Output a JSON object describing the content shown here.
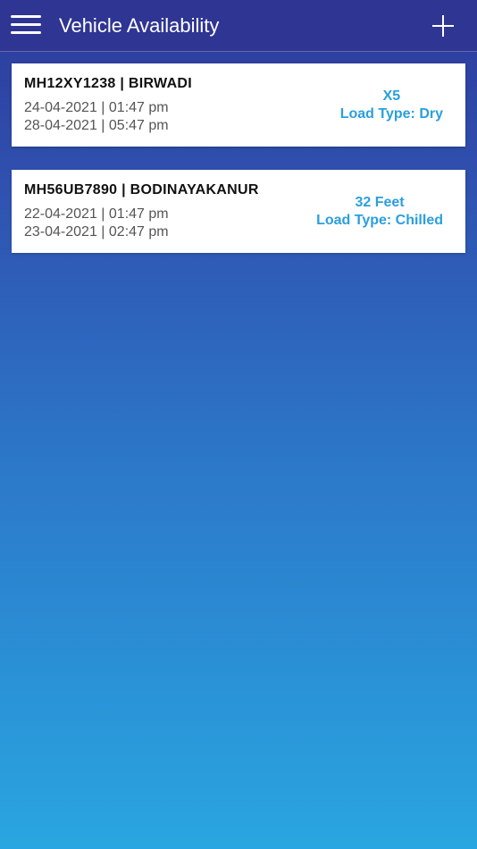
{
  "header": {
    "title": "Vehicle Availability"
  },
  "vehicles": [
    {
      "heading": "MH12XY1238 | BIRWADI",
      "start": "24-04-2021 | 01:47 pm",
      "end": "28-04-2021 | 05:47 pm",
      "size": "X5",
      "load_type": "Load Type: Dry"
    },
    {
      "heading": "MH56UB7890 | BODINAYAKANUR",
      "start": "22-04-2021 | 01:47 pm",
      "end": "23-04-2021 | 02:47 pm",
      "size": "32 Feet",
      "load_type": "Load Type: Chilled"
    }
  ],
  "colors": {
    "appbar": "#2f3593",
    "accent": "#2a9fdc",
    "gradient_top": "#2e3a9b",
    "gradient_bottom": "#29a6e1"
  },
  "icons": {
    "menu": "hamburger-menu-icon",
    "add": "plus-icon"
  }
}
